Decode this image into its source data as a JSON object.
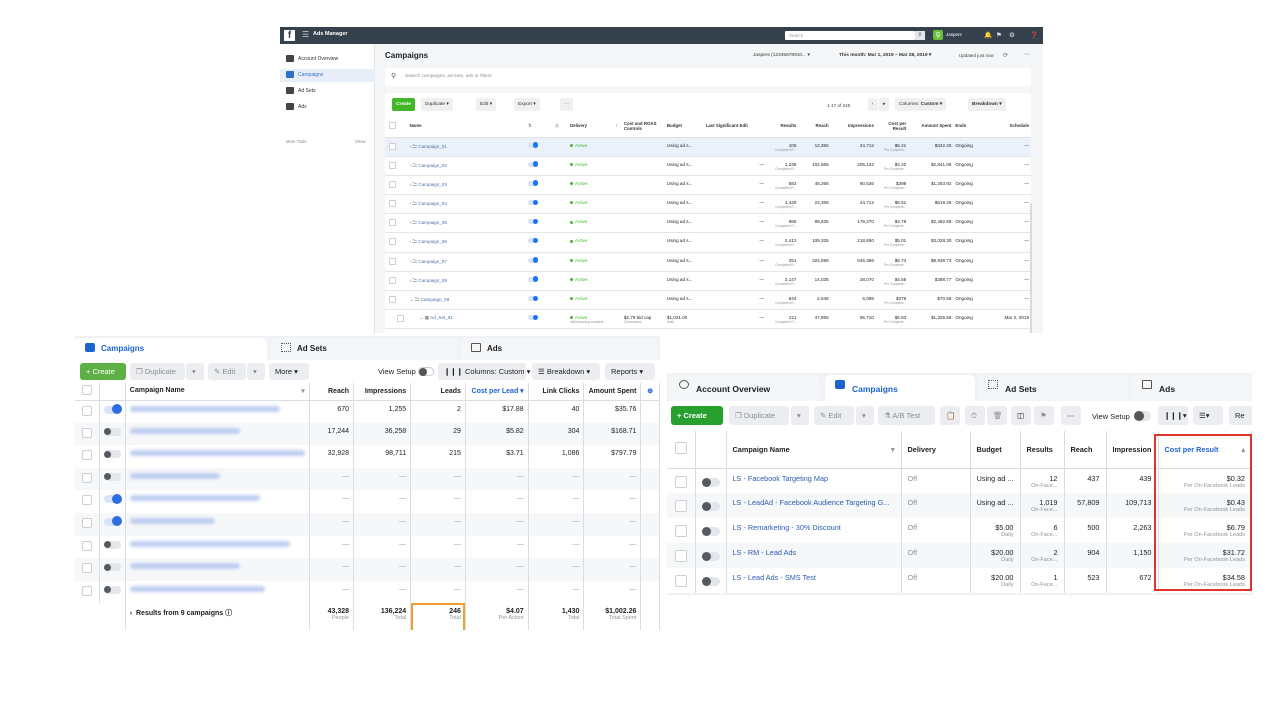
{
  "top_panel": {
    "app_name": "Ads Manager",
    "search_placeholder": "Search",
    "user_name": "Jaspers",
    "sidebar": [
      {
        "label": "Account Overview",
        "icon": "account-overview-icon"
      },
      {
        "label": "Campaigns",
        "icon": "folder-icon",
        "active": true
      },
      {
        "label": "Ad Sets",
        "icon": "grid-icon"
      },
      {
        "label": "Ads",
        "icon": "ad-icon"
      }
    ],
    "more_tools": "More Tools",
    "show": "Show",
    "page_title": "Campaigns",
    "account_selector": "Jaspers (12345678910... ▾",
    "date_range": "This month: Mar 1, 2019 – Mar 28, 2019 ▾",
    "updated": "Updated just now",
    "search_campaigns_placeholder": "Search campaigns, ad sets, ads or filters",
    "toolbar": {
      "create": "Create",
      "duplicate": "Duplicate ▾",
      "edit": "Edit ▾",
      "export": "Export ▾",
      "more": "⋯",
      "pager": "1-17 of 245",
      "columns_label": "Columns:",
      "columns_value": "Custom ▾",
      "breakdown": "Breakdown ▾"
    },
    "columns": [
      "Name",
      "",
      "",
      "Delivery",
      "Cost and ROAS Controls",
      "Budget",
      "Last Significant Edit",
      "Results",
      "Reach",
      "Impressions",
      "Cost per Result",
      "Amount Spent",
      "Ends",
      "Schedule"
    ],
    "rows": [
      {
        "name": "Campaign_01",
        "delivery": "Active",
        "bid": "",
        "budget": "Using ad s...",
        "edit": "",
        "results": "105",
        "results_sub": "Completed R...",
        "reach": "12,356",
        "impressions": "24,712",
        "cpr": "$6.21",
        "cpr_sub": "Per Complete...",
        "spent": "$342.26",
        "ends": "Ongoing",
        "schedule": "—",
        "selected": true
      },
      {
        "name": "Campaign_02",
        "delivery": "Active",
        "bid": "",
        "budget": "Using ad s...",
        "edit": "—",
        "results": "1,236",
        "results_sub": "Completed R...",
        "reach": "102,566",
        "impressions": "205,132",
        "cpr": "$4.22",
        "cpr_sub": "Per Complete...",
        "spent": "$2,841.08",
        "ends": "Ongoing",
        "schedule": "—"
      },
      {
        "name": "Campaign_03",
        "delivery": "Active",
        "bid": "",
        "budget": "Using ad s...",
        "edit": "—",
        "results": "582",
        "results_sub": "Completed R...",
        "reach": "45,268",
        "impressions": "90,536",
        "cpr": "$398",
        "cpr_sub": "Per Complete...",
        "spent": "$1,253.92",
        "ends": "Ongoing",
        "schedule": "—"
      },
      {
        "name": "Campaign_04",
        "delivery": "Active",
        "bid": "",
        "budget": "Using ad s...",
        "edit": "—",
        "results": "1,429",
        "results_sub": "Completed R...",
        "reach": "22,356",
        "impressions": "44,712",
        "cpr": "$6.51",
        "cpr_sub": "Per Complete...",
        "spent": "$619.26",
        "ends": "Ongoing",
        "schedule": "—"
      },
      {
        "name": "Campaign_05",
        "delivery": "Active",
        "bid": "",
        "budget": "Using ad s...",
        "edit": "—",
        "results": "985",
        "results_sub": "Completed R...",
        "reach": "89,635",
        "impressions": "179,270",
        "cpr": "$4.78",
        "cpr_sub": "Per Complete...",
        "spent": "$2,482.89",
        "ends": "Ongoing",
        "schedule": "—"
      },
      {
        "name": "Campaign_06",
        "delivery": "Active",
        "bid": "",
        "budget": "Using ad s...",
        "edit": "—",
        "results": "2,412",
        "results_sub": "Completed R...",
        "reach": "109,325",
        "impressions": "218,650",
        "cpr": "$5.01",
        "cpr_sub": "Per Complete...",
        "spent": "$3,028.30",
        "ends": "Ongoing",
        "schedule": "—"
      },
      {
        "name": "Campaign_07",
        "delivery": "Active",
        "bid": "",
        "budget": "Using ad s...",
        "edit": "—",
        "results": "251",
        "results_sub": "Completed R...",
        "reach": "322,698",
        "impressions": "645,396",
        "cpr": "$5.74",
        "cpr_sub": "Per Complete...",
        "spent": "$8,938.73",
        "ends": "Ongoing",
        "schedule": "—"
      },
      {
        "name": "Campaign_08",
        "delivery": "Active",
        "bid": "",
        "budget": "Using ad s...",
        "edit": "—",
        "results": "2,147",
        "results_sub": "Completed R...",
        "reach": "14,035",
        "impressions": "28,070",
        "cpr": "$4.56",
        "cpr_sub": "Per Complete...",
        "spent": "$388.77",
        "ends": "Ongoing",
        "schedule": "—"
      },
      {
        "name": "Campaign_09",
        "delivery": "Active",
        "bid": "",
        "budget": "Using ad s...",
        "edit": "—",
        "results": "844",
        "results_sub": "Completed R...",
        "reach": "2,548",
        "impressions": "5,096",
        "cpr": "$379",
        "cpr_sub": "Per Complete...",
        "spent": "$70.58",
        "ends": "Ongoing",
        "schedule": "—",
        "expanded": true
      },
      {
        "name": "Ad_Set_01",
        "delivery": "Active",
        "delivery_sub": "Initial learning complete",
        "bid": "$2.79 bid cap",
        "bid_sub": "Conversions",
        "budget": "$1,021.00",
        "budget_sub": "Daily",
        "edit": "—",
        "results": "211",
        "results_sub": "Completed R...",
        "reach": "47,855",
        "impressions": "95,710",
        "cpr": "$5.83",
        "cpr_sub": "Per Complete...",
        "spent": "$1,325.58",
        "ends": "Ongoing",
        "schedule": "Mar 2, 2019",
        "adset": true
      }
    ]
  },
  "bottom_left_panel": {
    "tabs": [
      {
        "label": "Campaigns",
        "active": true
      },
      {
        "label": "Ad Sets"
      },
      {
        "label": "Ads"
      }
    ],
    "toolbar": {
      "create": "+ Create",
      "duplicate": "Duplicate",
      "edit": "Edit",
      "more": "More ▾",
      "view_setup": "View Setup",
      "columns": "Columns: Custom ▾",
      "breakdown": "Breakdown ▾",
      "reports": "Reports ▾"
    },
    "columns": [
      "Campaign Name",
      "Reach",
      "Impressions",
      "Leads",
      "Cost per Lead ▾",
      "Link Clicks",
      "Amount Spent"
    ],
    "rows": [
      {
        "on": true,
        "reach": "670",
        "impressions": "1,255",
        "leads": "2",
        "cpl": "$17.88",
        "clicks": "40",
        "spent": "$35.76"
      },
      {
        "on": false,
        "reach": "17,244",
        "impressions": "36,258",
        "leads": "29",
        "cpl": "$5.82",
        "clicks": "304",
        "spent": "$168.71"
      },
      {
        "on": false,
        "reach": "32,928",
        "impressions": "98,711",
        "leads": "215",
        "cpl": "$3.71",
        "clicks": "1,086",
        "spent": "$797.79"
      },
      {
        "on": false,
        "reach": "—",
        "impressions": "—",
        "leads": "—",
        "cpl": "—",
        "clicks": "—",
        "spent": "—"
      },
      {
        "on": true,
        "reach": "—",
        "impressions": "—",
        "leads": "—",
        "cpl": "—",
        "clicks": "—",
        "spent": "—"
      },
      {
        "on": true,
        "reach": "—",
        "impressions": "—",
        "leads": "—",
        "cpl": "—",
        "clicks": "—",
        "spent": "—"
      },
      {
        "on": false,
        "reach": "—",
        "impressions": "—",
        "leads": "—",
        "cpl": "—",
        "clicks": "—",
        "spent": "—"
      },
      {
        "on": false,
        "reach": "—",
        "impressions": "—",
        "leads": "—",
        "cpl": "—",
        "clicks": "—",
        "spent": "—"
      },
      {
        "on": false,
        "reach": "—",
        "impressions": "—",
        "leads": "—",
        "cpl": "—",
        "clicks": "—",
        "spent": "—"
      }
    ],
    "totals": {
      "label": "Results from 9 campaigns",
      "reach": "43,328",
      "reach_sub": "People",
      "impressions": "136,224",
      "impressions_sub": "Total",
      "leads": "246",
      "leads_sub": "Total",
      "cpl": "$4.07",
      "cpl_sub": "Per Action",
      "clicks": "1,430",
      "clicks_sub": "Total",
      "spent": "$1,002.26",
      "spent_sub": "Total Spent"
    }
  },
  "right_panel": {
    "tabs": [
      {
        "label": "Account Overview"
      },
      {
        "label": "Campaigns",
        "active": true
      },
      {
        "label": "Ad Sets"
      },
      {
        "label": "Ads"
      }
    ],
    "toolbar": {
      "create": "+ Create",
      "duplicate": "Duplicate",
      "edit": "Edit",
      "ab_test": "A/B Test",
      "more": "⋯",
      "view_setup": "View Setup",
      "columns": "▾",
      "breakdown": "▾",
      "reports": "Re"
    },
    "columns": [
      "Campaign Name",
      "Delivery",
      "Budget",
      "Results",
      "Reach",
      "Impression",
      "Cost per Result"
    ],
    "rows": [
      {
        "name": "LS - Facebook Targeting Map",
        "delivery": "Off",
        "budget": "Using ad ...",
        "budget_sub": "",
        "results": "12",
        "results_sub": "On-Face...",
        "reach": "437",
        "impressions": "439",
        "cpr": "$0.32",
        "cpr_sub": "Per On-Facebook Leads"
      },
      {
        "name": "LS - LeadAd - Facebook Audience Targeting G...",
        "delivery": "Off",
        "budget": "Using ad ...",
        "budget_sub": "",
        "results": "1,019",
        "results_sub": "On-Face...",
        "reach": "57,809",
        "impressions": "109,713",
        "cpr": "$0.43",
        "cpr_sub": "Per On-Facebook Leads"
      },
      {
        "name": "LS - Remarketing - 30% Discount",
        "delivery": "Off",
        "budget": "$5.00",
        "budget_sub": "Daily",
        "results": "6",
        "results_sub": "On-Face...",
        "reach": "500",
        "impressions": "2,263",
        "cpr": "$6.79",
        "cpr_sub": "Per On-Facebook Leads"
      },
      {
        "name": "LS - RM - Lead Ads",
        "delivery": "Off",
        "budget": "$20.00",
        "budget_sub": "Daily",
        "results": "2",
        "results_sub": "On-Face...",
        "reach": "904",
        "impressions": "1,150",
        "cpr": "$31.72",
        "cpr_sub": "Per On-Facebook Leads"
      },
      {
        "name": "LS - Lead Ads - SMS Test",
        "delivery": "Off",
        "budget": "$20.00",
        "budget_sub": "Daily",
        "results": "1",
        "results_sub": "On-Face...",
        "reach": "523",
        "impressions": "672",
        "cpr": "$34.58",
        "cpr_sub": "Per On-Facebook Leads"
      }
    ]
  }
}
